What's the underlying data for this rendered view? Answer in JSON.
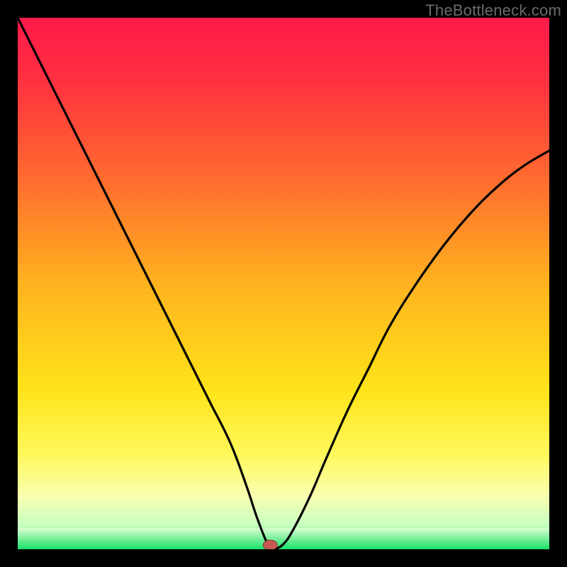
{
  "watermark": "TheBottleneck.com",
  "colors": {
    "frame": "#000000",
    "gradient_stops": [
      {
        "offset": 0.0,
        "color": "#ff1a4b"
      },
      {
        "offset": 0.12,
        "color": "#ff3140"
      },
      {
        "offset": 0.3,
        "color": "#ff6a2f"
      },
      {
        "offset": 0.5,
        "color": "#ffb21f"
      },
      {
        "offset": 0.7,
        "color": "#ffe319"
      },
      {
        "offset": 0.82,
        "color": "#fff85a"
      },
      {
        "offset": 0.9,
        "color": "#f9ffb0"
      },
      {
        "offset": 0.955,
        "color": "#c7ffc0"
      },
      {
        "offset": 0.985,
        "color": "#4fe f7f"
      },
      {
        "offset": 1.0,
        "color": "#17e06a"
      }
    ],
    "green_band_top": "#d9ffd0",
    "green_band_mid": "#7af09a",
    "green_band_bot": "#17e06a",
    "curve": "#000000",
    "marker_fill": "#c65a53",
    "marker_stroke": "#8c3a34"
  },
  "chart_data": {
    "type": "line",
    "title": "",
    "xlabel": "",
    "ylabel": "",
    "xlim": [
      0,
      100
    ],
    "ylim": [
      0,
      100
    ],
    "grid": false,
    "legend": false,
    "description": "V-shaped bottleneck curve over a red-to-green vertical gradient. Curve starts at top-left, dips to ~0 near x≈47, rises toward upper-right. A small reddish marker sits at the trough on the green band.",
    "series": [
      {
        "name": "bottleneck-curve",
        "x": [
          0,
          4,
          8,
          12,
          16,
          20,
          24,
          28,
          32,
          36,
          40,
          43,
          45,
          47,
          48,
          50,
          52,
          55,
          58,
          62,
          66,
          70,
          75,
          80,
          85,
          90,
          95,
          100
        ],
        "y": [
          100,
          92,
          84,
          76,
          68,
          60,
          52,
          44,
          36,
          28,
          20,
          12,
          6,
          1,
          0,
          1,
          4,
          10,
          17,
          26,
          34,
          42,
          50,
          57,
          63,
          68,
          72,
          75
        ]
      }
    ],
    "marker": {
      "x": 47.5,
      "y": 0.8
    },
    "green_band_y": [
      0,
      4
    ]
  }
}
